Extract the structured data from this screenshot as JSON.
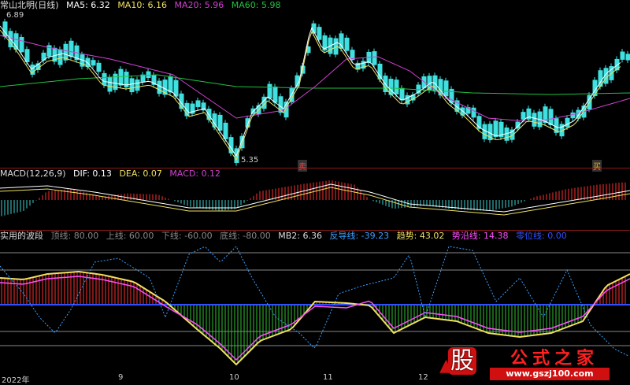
{
  "main": {
    "title": "常山北明(日线)",
    "ma": [
      {
        "label": "MA5: 6.32",
        "color": "#ffffff"
      },
      {
        "label": "MA10: 6.16",
        "color": "#f0e060"
      },
      {
        "label": "MA20: 5.96",
        "color": "#d040d0"
      },
      {
        "label": "MA60: 5.98",
        "color": "#20c040"
      }
    ],
    "high_label": "6.89",
    "low_label": "5.35",
    "signal_sell": "卖",
    "signal_buy": "买"
  },
  "macd": {
    "title": "MACD(12,26,9)",
    "dif": "DIF: 0.13",
    "dea": "DEA: 0.07",
    "macd": "MACD: 0.12",
    "colors": {
      "dif": "#ffffff",
      "dea": "#f0e060",
      "macd": "#d040d0"
    }
  },
  "wave": {
    "title": "实用的波段",
    "items": [
      {
        "label": "顶线: 80.00",
        "color": "#888888"
      },
      {
        "label": "上线: 60.00",
        "color": "#888888"
      },
      {
        "label": "下线: -60.00",
        "color": "#888888"
      },
      {
        "label": "底线: -80.00",
        "color": "#888888"
      },
      {
        "label": "MB2: 6.36",
        "color": "#dddddd"
      },
      {
        "label": "反导线: -39.23",
        "color": "#3aa0ff"
      },
      {
        "label": "趋势: 43.02",
        "color": "#f0e060"
      },
      {
        "label": "势沿线: 14.38",
        "color": "#ff50ff"
      },
      {
        "label": "零位线: 0.00",
        "color": "#3050ff"
      }
    ]
  },
  "dates": [
    "2022年",
    "9",
    "10",
    "11",
    "12"
  ],
  "watermark": {
    "logo_char": "股",
    "site_name": "公式之家",
    "url": "www.gszj100.com"
  }
}
